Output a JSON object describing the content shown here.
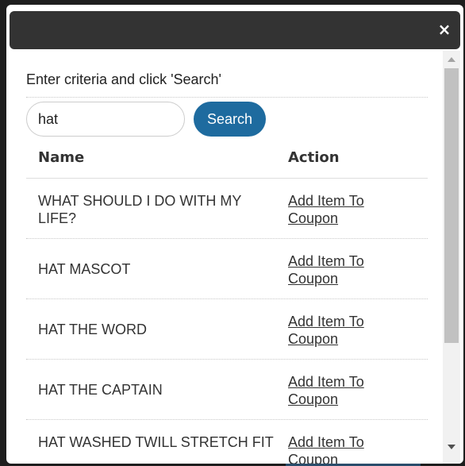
{
  "dialog": {
    "close_glyph": "×"
  },
  "search": {
    "instructions": "Enter criteria and click 'Search'",
    "query": "hat",
    "button_label": "Search"
  },
  "table": {
    "headers": {
      "name": "Name",
      "action": "Action"
    },
    "rows": [
      {
        "name": "WHAT SHOULD I DO WITH MY LIFE?",
        "action": "Add Item To Coupon"
      },
      {
        "name": "HAT MASCOT",
        "action": "Add Item To Coupon"
      },
      {
        "name": "HAT THE WORD",
        "action": "Add Item To Coupon"
      },
      {
        "name": "HAT THE CAPTAIN",
        "action": "Add Item To Coupon"
      },
      {
        "name": "HAT WASHED TWILL STRETCH FIT",
        "action": "Add Item To Coupon"
      }
    ]
  },
  "colors": {
    "titlebar": "#333333",
    "search_button": "#1e6b9f",
    "scrollbar_track": "#f1f1f1",
    "scrollbar_thumb": "#c1c1c1"
  }
}
